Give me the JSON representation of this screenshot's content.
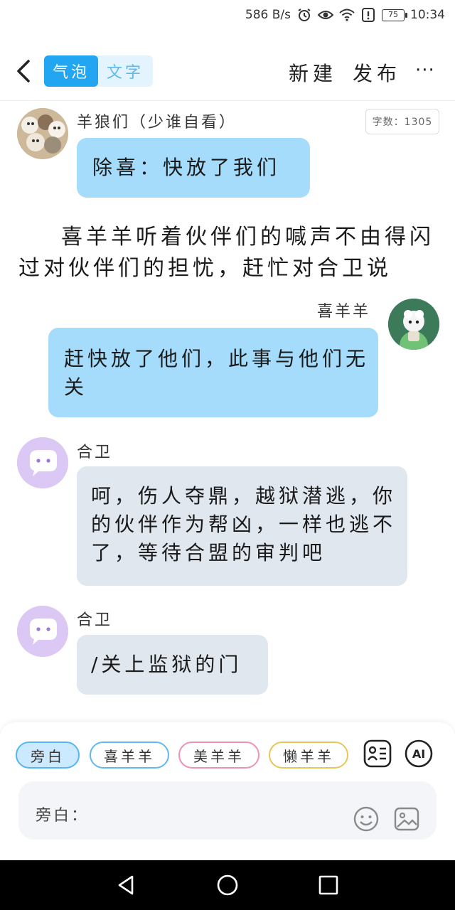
{
  "status_bar": {
    "speed": "586 B/s",
    "battery": "75",
    "time": "10:34"
  },
  "header": {
    "seg_bubble": "气泡",
    "seg_text": "文字",
    "new_label": "新建",
    "publish_label": "发布",
    "more_label": "···"
  },
  "chat": {
    "counter": "字数：1305",
    "messages": [
      {
        "speaker": "羊狼们（少谁自看）",
        "text": "除喜：快放了我们"
      },
      {
        "speaker": "喜羊羊",
        "text": "赶快放了他们，此事与他们无关"
      },
      {
        "speaker": "合卫",
        "text": "呵，伤人夺鼎，越狱潜逃，你的伙伴作为帮凶，一样也逃不了，等待合盟的审判吧"
      },
      {
        "speaker": "合卫",
        "text": "/关上监狱的门"
      }
    ],
    "narration": "喜羊羊听着伙伴们的喊声不由得闪过对伙伴们的担忧，赶忙对合卫说"
  },
  "composer": {
    "roles": [
      "旁白",
      "喜羊羊",
      "美羊羊",
      "懒羊羊"
    ],
    "ai_label": "AI",
    "input_label": "旁白："
  },
  "colors": {
    "accent": "#23a6f2",
    "bubble_blue": "#a6dcfb",
    "bubble_gray": "#e1e7ef"
  }
}
